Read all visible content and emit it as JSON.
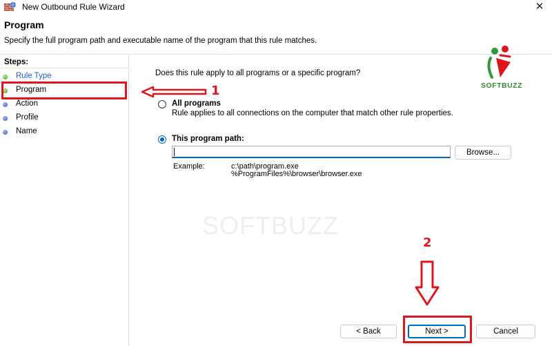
{
  "window": {
    "title": "New Outbound Rule Wizard",
    "close_glyph": "✕"
  },
  "header": {
    "title": "Program",
    "description": "Specify the full program path and executable name of the program that this rule matches."
  },
  "steps": {
    "heading": "Steps:",
    "items": [
      {
        "label": "Rule Type",
        "state": "completed"
      },
      {
        "label": "Program",
        "state": "current"
      },
      {
        "label": "Action",
        "state": "pending"
      },
      {
        "label": "Profile",
        "state": "pending"
      },
      {
        "label": "Name",
        "state": "pending"
      }
    ]
  },
  "main": {
    "question": "Does this rule apply to all programs or a specific program?",
    "options": [
      {
        "label": "All programs",
        "description": "Rule applies to all connections on the computer that match other rule properties.",
        "selected": false
      },
      {
        "label": "This program path:",
        "selected": true
      }
    ],
    "path_input": {
      "value": "",
      "placeholder": ""
    },
    "browse_label": "Browse...",
    "example_label": "Example:",
    "example_lines": [
      "c:\\path\\program.exe",
      "%ProgramFiles%\\browser\\browser.exe"
    ]
  },
  "buttons": {
    "back": "< Back",
    "next": "Next >",
    "cancel": "Cancel"
  },
  "branding": {
    "watermark": "SOFTBUZZ",
    "logo_text": "SOFTBUZZ"
  },
  "annotations": {
    "marker_1": "1",
    "marker_2": "2",
    "color": "#e0141b"
  },
  "colors": {
    "accent": "#0067c0",
    "link": "#1f5ec9",
    "annotation_red": "#e0141b"
  }
}
